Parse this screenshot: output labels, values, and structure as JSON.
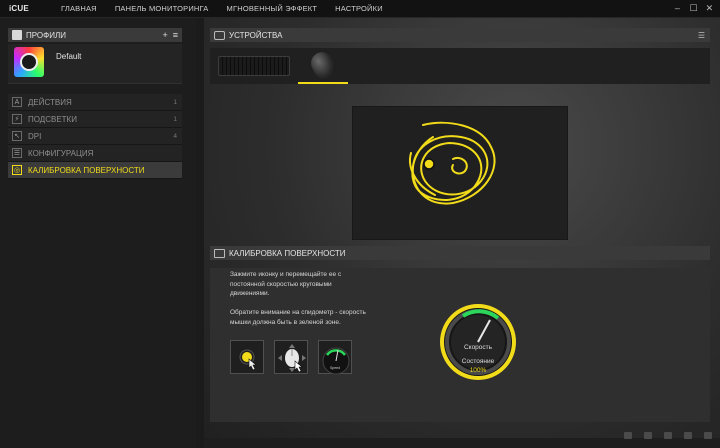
{
  "app": {
    "logo": "iCUE"
  },
  "nav": [
    {
      "label": "ГЛАВНАЯ"
    },
    {
      "label": "ПАНЕЛЬ МОНИТОРИНГА"
    },
    {
      "label": "МГНОВЕННЫЙ ЭФФЕКТ"
    },
    {
      "label": "НАСТРОЙКИ"
    }
  ],
  "window_controls": {
    "minimize": "–",
    "maximize": "☐",
    "close": "✕"
  },
  "profiles": {
    "header": "ПРОФИЛИ",
    "add_label": "+",
    "menu_label": "≡",
    "current": {
      "name": "Default"
    }
  },
  "menu": [
    {
      "label": "ДЕЙСТВИЯ",
      "icon": "A",
      "count": "1"
    },
    {
      "label": "ПОДСВЕТКИ",
      "icon": "⚡",
      "count": "1"
    },
    {
      "label": "DPI",
      "icon": "↖",
      "count": "4"
    },
    {
      "label": "КОНФИГУРАЦИЯ",
      "icon": "☰",
      "count": ""
    },
    {
      "label": "КАЛИБРОВКА ПОВЕРХНОСТИ",
      "icon": "◎",
      "count": ""
    }
  ],
  "devices": {
    "header": "УСТРОЙСТВА",
    "items": [
      {
        "name": "keyboard",
        "selected": false
      },
      {
        "name": "mouse",
        "selected": true
      }
    ]
  },
  "calibration": {
    "header": "КАЛИБРОВКА ПОВЕРХНОСТИ",
    "instruction_1": "Зажмите иконку и перемещайте ее с постоянной скоростью круговыми движениями.",
    "instruction_2": "Обратите внимание на спидометр - скорость мышки должна быть в зеленой зоне.",
    "tile_speed_label": "Speed",
    "speed_label": "Скорость",
    "status_label": "Состояние",
    "status_value": "100%"
  },
  "colors": {
    "accent": "#f2dc19",
    "gauge_green": "#2bd65a"
  },
  "social_icons": [
    "share-icon",
    "chat-icon",
    "twitter-icon",
    "facebook-icon",
    "corsair-icon"
  ]
}
